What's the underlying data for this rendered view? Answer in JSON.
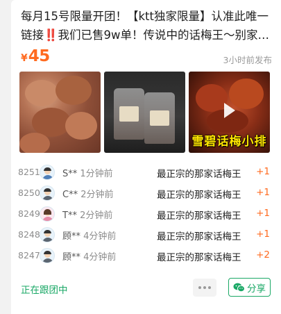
{
  "post": {
    "title": "每月15号限量开团！【ktt独家限量】认准此唯一链接‼️我们已售9w单！传说中的话梅王～别家…",
    "price_symbol": "¥",
    "price": "45",
    "posted": "3小时前发布"
  },
  "images": [
    {
      "icon": "dried-plums-photo"
    },
    {
      "icon": "product-bags-photo"
    },
    {
      "icon": "video-thumbnail",
      "caption": "雪碧话梅小排"
    }
  ],
  "orders": [
    {
      "seq": "8251",
      "user": "S**",
      "time": "1分钟前",
      "product": "最正宗的那家话梅王",
      "qty": "+1",
      "avatar": "boy"
    },
    {
      "seq": "8250",
      "user": "C**",
      "time": "2分钟前",
      "product": "最正宗的那家话梅王",
      "qty": "+1",
      "avatar": "boy"
    },
    {
      "seq": "8249",
      "user": "T**",
      "time": "2分钟前",
      "product": "最正宗的那家话梅王",
      "qty": "+1",
      "avatar": "girl"
    },
    {
      "seq": "8248",
      "user": "顾**",
      "time": "4分钟前",
      "product": "最正宗的那家话梅王",
      "qty": "+1",
      "avatar": "man"
    },
    {
      "seq": "8247",
      "user": "顾**",
      "time": "4分钟前",
      "product": "最正宗的那家话梅王",
      "qty": "+2",
      "avatar": "man"
    }
  ],
  "footer": {
    "status": "正在跟团中",
    "more_icon": "ellipsis-icon",
    "share_icon": "wechat-icon",
    "share_label": "分享"
  },
  "colors": {
    "accent": "#ff6a1f",
    "green": "#1aa866"
  }
}
